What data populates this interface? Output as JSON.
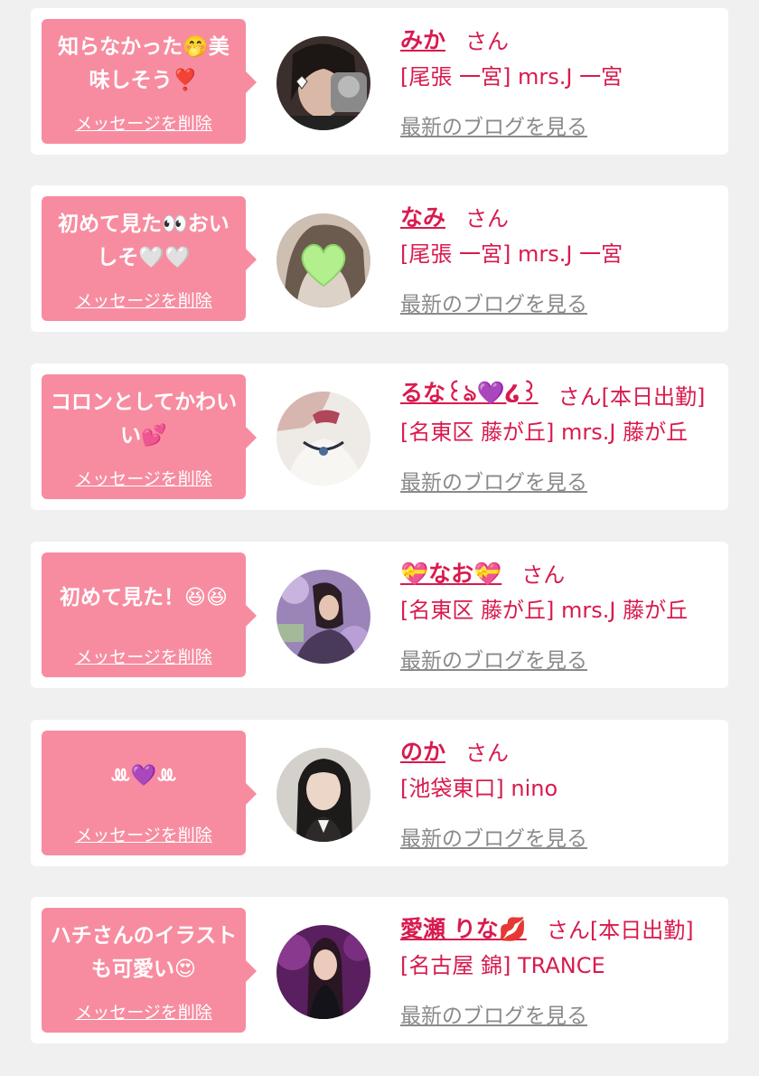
{
  "colors": {
    "background": "#f0f0f0",
    "card": "#ffffff",
    "bubble": "#f78ca0",
    "accent": "#d81b4e",
    "link_gray": "#8a8a8a"
  },
  "messages": [
    {
      "message": "知らなかった🤭美味しそう❣️",
      "delete_label": "メッセージを削除",
      "name": "みか",
      "honorific": "さん",
      "shop": "[尾張 一宮] mrs.J 一宮",
      "blog_label": "最新のブログを見る"
    },
    {
      "message": "初めて見た👀おいしそ🤍🤍",
      "delete_label": "メッセージを削除",
      "name": "なみ",
      "honorific": "さん",
      "shop": "[尾張 一宮] mrs.J 一宮",
      "blog_label": "最新のブログを見る"
    },
    {
      "message": "コロンとしてかわいい💕",
      "delete_label": "メッセージを削除",
      "name": "るな꒰ঌ💜໒꒱",
      "honorific": "さん[本日出勤]",
      "shop": "[名東区 藤が丘] mrs.J 藤が丘",
      "blog_label": "最新のブログを見る"
    },
    {
      "message": "初めて見た！😆😆",
      "delete_label": "メッセージを削除",
      "name": "💝なお💝",
      "honorific": "さん",
      "shop": "[名東区 藤が丘] mrs.J 藤が丘",
      "blog_label": "最新のブログを見る"
    },
    {
      "message": "ꔛ💜ꔛ",
      "delete_label": "メッセージを削除",
      "name": "のか",
      "honorific": "さん",
      "shop": "[池袋東口] nino",
      "blog_label": "最新のブログを見る"
    },
    {
      "message": "ハチさんのイラストも可愛い😍",
      "delete_label": "メッセージを削除",
      "name": "愛瀬 りな💋",
      "honorific": "さん[本日出勤]",
      "shop": "[名古屋 錦] TRANCE",
      "blog_label": "最新のブログを見る"
    }
  ]
}
